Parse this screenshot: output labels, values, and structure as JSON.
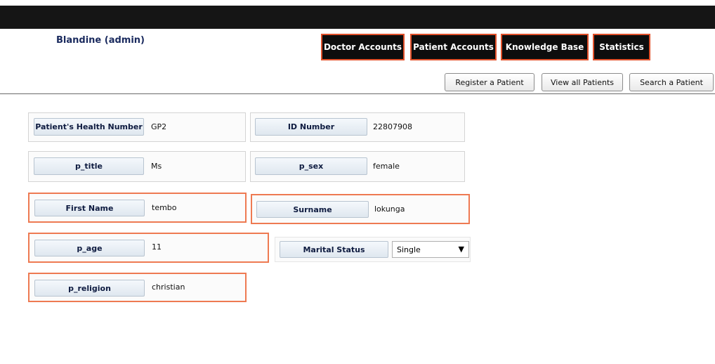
{
  "header": {
    "user": "Blandine (admin)"
  },
  "nav": {
    "doctor": "Doctor Accounts",
    "patient": "Patient Accounts",
    "knowledge": "Knowledge Base",
    "statistics": "Statistics"
  },
  "subnav": {
    "register": "Register a Patient",
    "view_all": "View all Patients",
    "search": "Search a Patient"
  },
  "form": {
    "health_number": {
      "label": "Patient's Health Number",
      "value": "GP2"
    },
    "id_number": {
      "label": "ID Number",
      "value": "22807908"
    },
    "title": {
      "label": "p_title",
      "value": "Ms"
    },
    "sex": {
      "label": "p_sex",
      "value": "female"
    },
    "first_name": {
      "label": "First Name",
      "value": "tembo"
    },
    "surname": {
      "label": "Surname",
      "value": "lokunga"
    },
    "age": {
      "label": "p_age",
      "value": "11"
    },
    "marital_status": {
      "label": "Marital Status",
      "selected": "Single"
    },
    "religion": {
      "label": "p_religion",
      "value": "christian"
    }
  },
  "icons": {
    "dropdown": "chevron-down-icon"
  },
  "colors": {
    "accent_border": "#ee7a52",
    "topbar": "#151515"
  }
}
